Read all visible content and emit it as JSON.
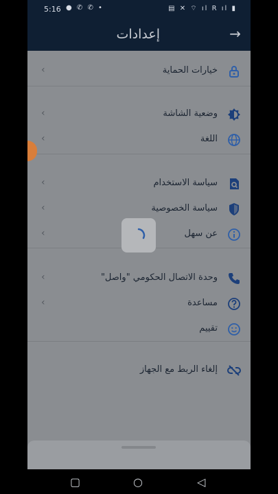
{
  "status_bar": {
    "time": "5:16",
    "left_icons": "● ✆ ✆ •",
    "right_icons": "▤ ✕ ⌔ ıl R ıl ▮"
  },
  "app_bar": {
    "title": "إعدادات",
    "back_icon": "arrow-right-icon"
  },
  "settings": {
    "security": {
      "label": "خيارات الحماية"
    },
    "display_mode": {
      "label": "وضعية الشاشة"
    },
    "language": {
      "label": "اللغة"
    },
    "terms": {
      "label": "سياسة الاستخدام"
    },
    "privacy": {
      "label": "سياسة الخصوصية"
    },
    "about": {
      "label": "عن سهل"
    },
    "contact": {
      "label": "وحدة الاتصال الحكومي \"واصل\""
    },
    "help": {
      "label": "مساعدة"
    },
    "rating": {
      "label": "تقييم"
    },
    "unlink": {
      "label": "إلغاء الربط مع الجهاز"
    }
  },
  "colors": {
    "accent": "#2f5fa8",
    "overlay": "#8a8d91",
    "header": "#0f1f33"
  }
}
